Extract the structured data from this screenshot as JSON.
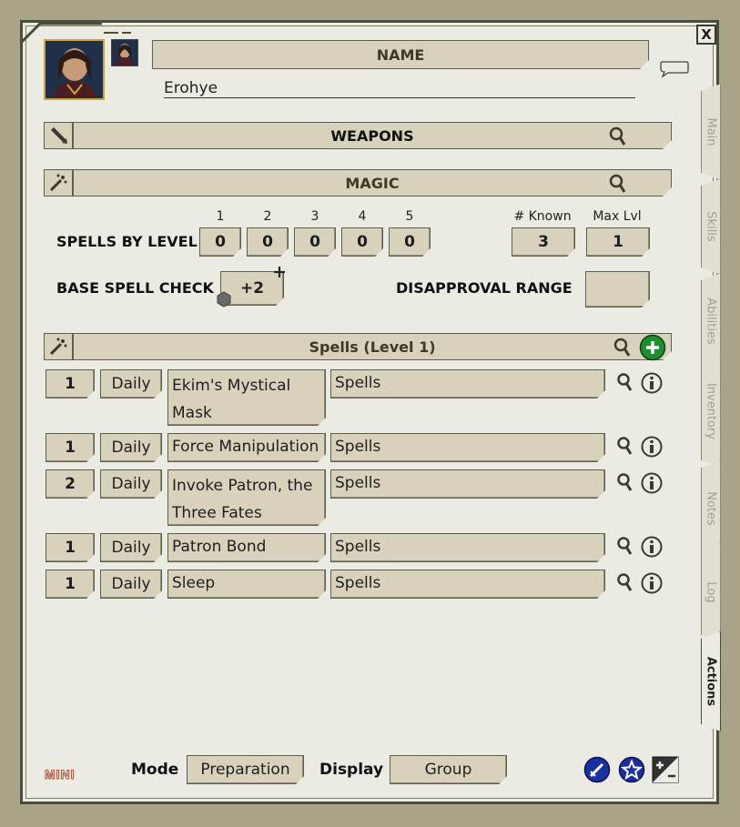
{
  "header": {
    "name_label": "NAME",
    "name_value": "Erohye"
  },
  "sections": {
    "weapons_label": "WEAPONS",
    "magic_label": "MAGIC"
  },
  "spells_by_level": {
    "label": "SPELLS BY LEVEL",
    "levels": [
      "1",
      "2",
      "3",
      "4",
      "5"
    ],
    "values": [
      "0",
      "0",
      "0",
      "0",
      "0"
    ],
    "known_label": "# Known",
    "known_value": "3",
    "maxlvl_label": "Max Lvl",
    "maxlvl_value": "1"
  },
  "spell_check": {
    "label": "BASE SPELL CHECK",
    "value": "+2",
    "disapproval_label": "DISAPPROVAL RANGE",
    "disapproval_value": ""
  },
  "spell_list": {
    "title": "Spells (Level 1)",
    "rows": [
      {
        "level": "1",
        "freq": "Daily",
        "name": "Ekim's Mystical Mask",
        "group": "Spells"
      },
      {
        "level": "1",
        "freq": "Daily",
        "name": "Force Manipulation",
        "group": "Spells"
      },
      {
        "level": "2",
        "freq": "Daily",
        "name": "Invoke Patron, the Three Fates",
        "group": "Spells"
      },
      {
        "level": "1",
        "freq": "Daily",
        "name": "Patron Bond",
        "group": "Spells"
      },
      {
        "level": "1",
        "freq": "Daily",
        "name": "Sleep",
        "group": "Spells"
      }
    ]
  },
  "footer": {
    "mini_label": "MINI",
    "mode_label": "Mode",
    "mode_value": "Preparation",
    "display_label": "Display",
    "display_value": "Group"
  },
  "tabs": [
    "Main",
    "Skills",
    "Abilities",
    "Inventory",
    "Notes",
    "Log",
    "Actions"
  ],
  "window": {
    "close_label": "X"
  },
  "colors": {
    "background": "#a9a487",
    "panel": "#ecebe3",
    "field": "#d8d2bd",
    "border": "#4a4d3c",
    "accent_green": "#1e8f2e",
    "accent_blue": "#1a2fa0"
  }
}
